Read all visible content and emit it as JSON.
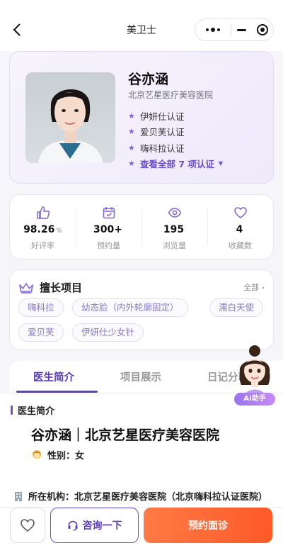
{
  "nav": {
    "title": "美卫士"
  },
  "doctor": {
    "name": "谷亦涵",
    "hospital": "北京艺星医疗美容医院",
    "certifications": [
      "伊妍仕认证",
      "爱贝芙认证",
      "嗨科拉认证"
    ],
    "view_all": "查看全部 7 项认证"
  },
  "stats": [
    {
      "icon": "thumbs-up-icon",
      "value": "98.26",
      "unit": "%",
      "label": "好评率"
    },
    {
      "icon": "calendar-check-icon",
      "value": "300+",
      "unit": "",
      "label": "预约量"
    },
    {
      "icon": "eye-icon",
      "value": "195",
      "unit": "",
      "label": "浏览量"
    },
    {
      "icon": "heart-icon",
      "value": "4",
      "unit": "",
      "label": "收藏数"
    }
  ],
  "skills": {
    "title": "擅长项目",
    "all_label": "全部 ›",
    "tags": [
      "嗨科拉",
      "幼态脸（内外轮廓固定）",
      "濡白天使",
      "爱贝芙",
      "伊妍仕少女针"
    ]
  },
  "tabs": [
    "医生简介",
    "项目展示",
    "日记分享"
  ],
  "intro": {
    "section_title": "医生简介",
    "headline": "谷亦涵｜北京艺星医疗美容医院",
    "gender": "性别：女",
    "institution": "所在机构：北京艺星医疗美容医院（北京嗨科拉认证医院）"
  },
  "ai_helper": {
    "badge": "AI助手"
  },
  "bottom": {
    "consult": "咨询一下",
    "book": "预约面诊"
  },
  "colors": {
    "accent": "#6a4fcf",
    "cta": "#ff6a35",
    "tag_text": "#8a78c6"
  }
}
